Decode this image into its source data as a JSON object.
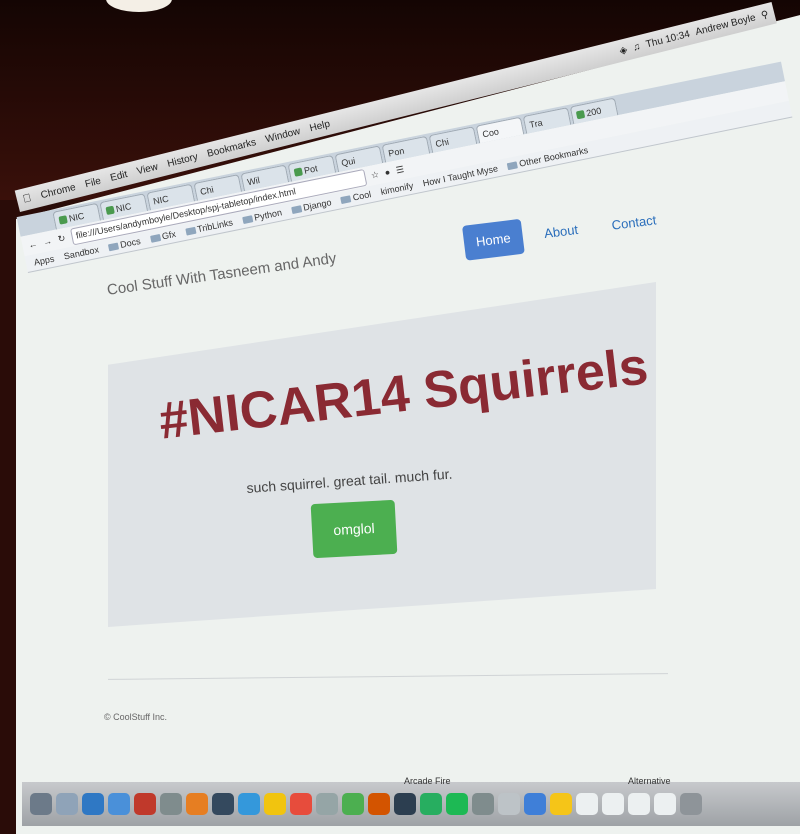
{
  "menubar": {
    "app": "Chrome",
    "items": [
      "File",
      "Edit",
      "View",
      "History",
      "Bookmarks",
      "Window",
      "Help"
    ],
    "clock": "Thu 10:34",
    "user": "Andrew Boyle"
  },
  "browser": {
    "tabs": [
      "NIC",
      "NIC",
      "NIC",
      "Chi",
      "Wil",
      "Pot",
      "Qui",
      "Pon",
      "Chi",
      "Coo",
      "Tra",
      "200"
    ],
    "active_tab": "Coo",
    "url": "file:///Users/andymboyle/Desktop/spj-tabletop/index.html",
    "bookmarks": [
      "Apps",
      "Sandbox",
      "Docs",
      "Gfx",
      "TribLinks",
      "Python",
      "Django",
      "Cool",
      "kimonify",
      "How I Taught Myse",
      "Other Bookmarks"
    ]
  },
  "page": {
    "brand": "Cool Stuff With Tasneem and Andy",
    "nav": [
      "Home",
      "About",
      "Contact"
    ],
    "headline": "#NICAR14 Squirrels",
    "subline": "such squirrel. great tail. much fur.",
    "button": "omglol",
    "footer": "© CoolStuff Inc."
  },
  "dock": {
    "labels": [
      "Arcade Fire",
      "Alternative"
    ]
  },
  "colors": {
    "headline": "#8a2a33",
    "button": "#4caf50",
    "nav_active": "#4a7fd0",
    "link": "#2a6ebb",
    "jumbotron": "#dfe3e6"
  }
}
